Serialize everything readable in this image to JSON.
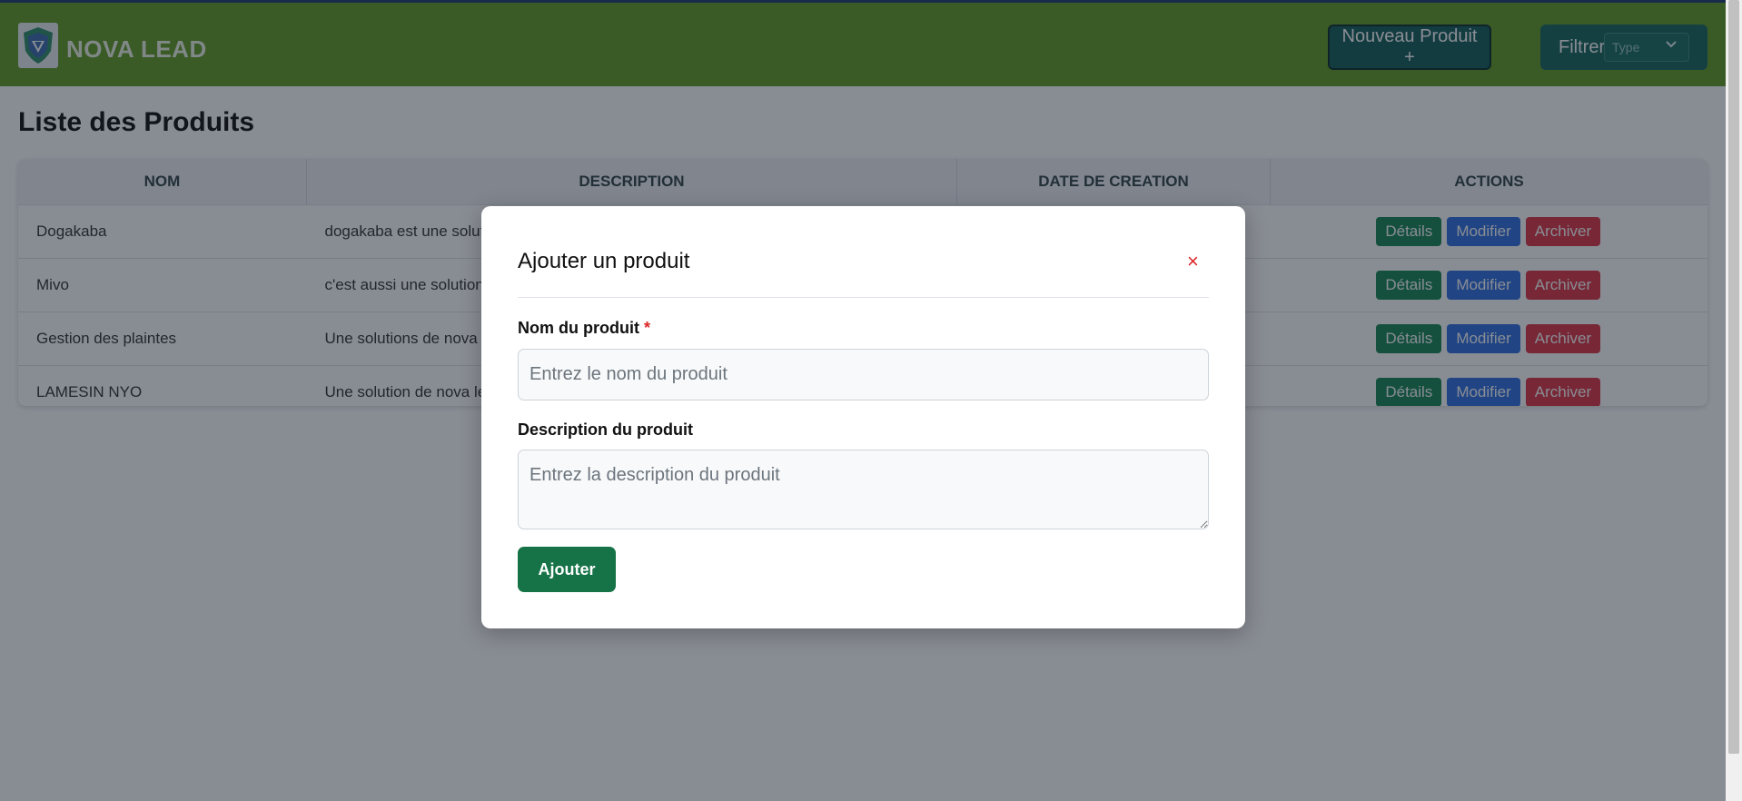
{
  "brand": {
    "name": "NOVA LEAD"
  },
  "header": {
    "new_product_label": "Nouveau Produit +",
    "filter_label": "Filtrer",
    "filter_select_value": "Type",
    "filter_chevron": "⌄"
  },
  "page": {
    "title": "Liste des Produits"
  },
  "table": {
    "columns": [
      "NOM",
      "DESCRIPTION",
      "DATE DE CREATION",
      "ACTIONS"
    ],
    "rows": [
      {
        "nom": "Dogakaba",
        "description": "dogakaba est une soluti",
        "date": ""
      },
      {
        "nom": "Mivo",
        "description": "c'est aussi une solution d",
        "date": ""
      },
      {
        "nom": "Gestion des plaintes",
        "description": "Une solutions de nova le",
        "date": ""
      },
      {
        "nom": "LAMESIN NYO",
        "description": "Une solution de nova lea",
        "date": ""
      }
    ],
    "actions": {
      "details": "Détails",
      "modify": "Modifier",
      "archive": "Archiver"
    }
  },
  "modal": {
    "title": "Ajouter un produit",
    "close_symbol": "×",
    "name_label": "Nom du produit",
    "required_mark": "*",
    "name_placeholder": "Entrez le nom du produit",
    "name_value": "",
    "description_label": "Description du produit",
    "description_placeholder": "Entrez la description du produit",
    "description_value": "",
    "submit_label": "Ajouter"
  },
  "colors": {
    "header_bg": "#629b24",
    "primary_dark": "#155e58",
    "success": "#198754",
    "primary": "#2f6fe0",
    "danger": "#dc3545"
  }
}
